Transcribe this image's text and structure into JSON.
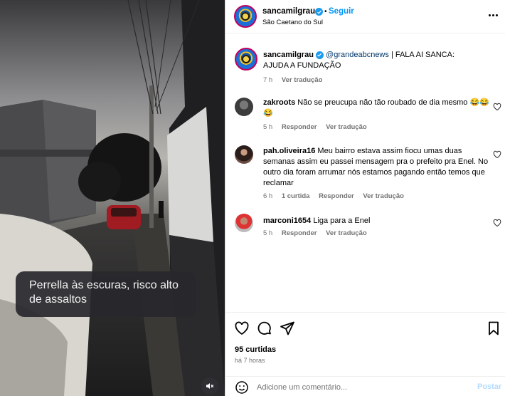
{
  "post": {
    "author": "sancamilgrau",
    "follow_label": "Seguir",
    "separator": "•",
    "location": "São Caetano do Sul"
  },
  "media": {
    "caption_text": "Perrella às escuras, risco alto de assaltos"
  },
  "caption": {
    "username": "sancamilgrau",
    "mention": "@grandeabcnews",
    "text": " | FALA AI SANCA: AJUDA A FUNDAÇÃO",
    "time": "7 h",
    "translate": "Ver tradução"
  },
  "comments": [
    {
      "username": "zakroots",
      "text": " Não se preucupa não tão roubado de dia mesmo 😂😂😂",
      "time": "5 h",
      "likes": "",
      "reply": "Responder",
      "translate": "Ver tradução"
    },
    {
      "username": "pah.oliveira16",
      "text": " Meu bairro estava assim fiocu umas duas semanas assim eu passei mensagem pra o prefeito pra Enel. No outro dia foram arrumar nós estamos pagando então temos que reclamar",
      "time": "6 h",
      "likes": "1 curtida",
      "reply": "Responder",
      "translate": "Ver tradução"
    },
    {
      "username": "marconi1654",
      "text": " Liga para a Enel",
      "time": "5 h",
      "likes": "",
      "reply": "Responder",
      "translate": "Ver tradução"
    }
  ],
  "footer": {
    "likes": "95 curtidas",
    "time": "há 7 horas",
    "comment_placeholder": "Adicione um comentário...",
    "post_label": "Postar"
  },
  "colors": {
    "accent": "#0095f6",
    "verified": "#1d9bf0",
    "muted": "#737373"
  }
}
